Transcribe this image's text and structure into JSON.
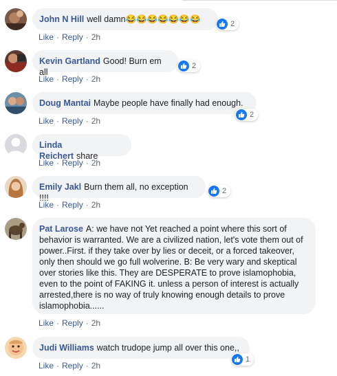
{
  "comments": [
    {
      "author": "John N Hill",
      "text": "well damn",
      "emoji": "😂😂😂😂😂😂😂",
      "reactions": "2",
      "like": "Like",
      "reply": "Reply",
      "time": "2h"
    },
    {
      "author": "Kevin Gartland",
      "text": "Good! Burn em all",
      "reactions": "2",
      "like": "Like",
      "reply": "Reply",
      "time": "2h"
    },
    {
      "author": "Doug Mantai",
      "text": "Maybe people have finally had enough.",
      "reactions": "2",
      "like": "Like",
      "reply": "Reply",
      "time": "2h"
    },
    {
      "author": "Linda Reichert",
      "text": "share",
      "like": "Like",
      "reply": "Reply",
      "time": "2h"
    },
    {
      "author": "Emily Jakl",
      "text": "Burn them all, no exception !!!!",
      "reactions": "2",
      "like": "Like",
      "reply": "Reply",
      "time": "2h"
    },
    {
      "author": "Pat Larose",
      "text": "A: we have not Yet reached a point where this sort of behavior is warranted. We are a civilized nation, let's vote them out of power..First. if they take over by lies or deceit, or a forced takeover, only then should we go full wolverine. B: Be very wary and skeptical over stories like this. They are DESPERATE to prove islamophobia, even to the point of FAKING it. unless a person of interest is actually arrested,there is no way of truly knowing enough details to prove islamophobia......",
      "like": "Like",
      "reply": "Reply",
      "time": "2h"
    },
    {
      "author": "Judi Williams",
      "text": "watch trudope jump all over this one,,",
      "reactions": "1",
      "like": "Like",
      "reply": "Reply",
      "time": "2h"
    }
  ],
  "colors": {
    "author": "#385898",
    "bubble": "#f2f3f5",
    "like_badge": "#1877f2",
    "meta": "#606770"
  },
  "icons": [
    "thumbs-up-icon",
    "avatar"
  ]
}
